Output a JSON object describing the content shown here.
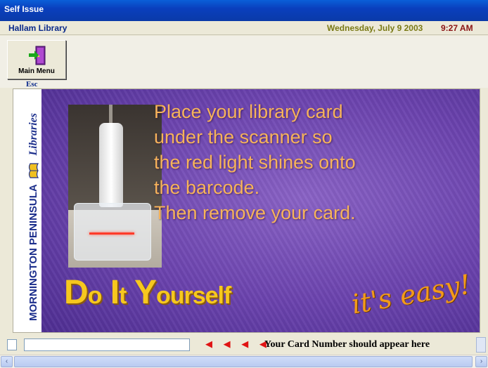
{
  "window": {
    "title": "Self Issue"
  },
  "info": {
    "library": "Hallam Library",
    "date": "Wednesday, July 9 2003",
    "time": "9:27 AM"
  },
  "toolbar": {
    "main_menu_label": "Main Menu",
    "shortcut": "Esc",
    "main_menu_icon": "exit-door-icon"
  },
  "sidebar": {
    "brand": "MORNINGTON PENINSULA",
    "brand_suffix": "Libraries",
    "logo_icon": "open-book-icon"
  },
  "poster": {
    "instructions": [
      "Place your library card",
      "under the scanner so",
      "the red light shines onto",
      "the barcode.",
      "Then remove your card."
    ],
    "diy": {
      "d": "D",
      "o": "o",
      "i": "I",
      "t": "t",
      "y": "Y",
      "ourself": "ourself"
    },
    "slogan": "it's easy!"
  },
  "bottom": {
    "card_number_value": "",
    "arrows": "◀ ◀ ◀ ◀",
    "hint": "Your Card Number should appear here"
  },
  "colors": {
    "titlebar": "#0a3fbd",
    "library": "#0b2a8a",
    "date": "#7a7a16",
    "time": "#8a1414",
    "instruction_text": "#f6b35a",
    "diy": "#f6c81e"
  }
}
